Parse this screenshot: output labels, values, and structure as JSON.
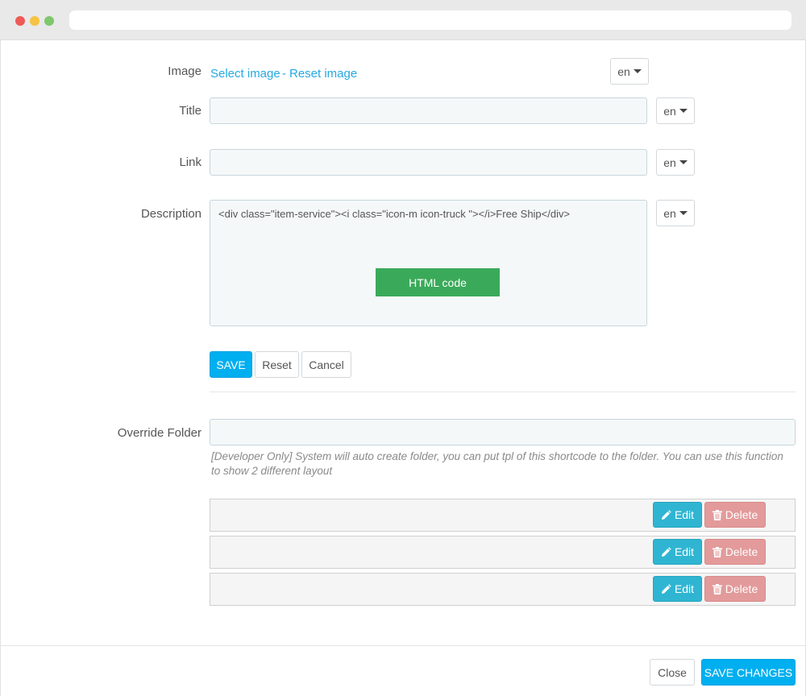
{
  "form": {
    "image": {
      "label": "Image",
      "select_link": "Select image",
      "separator": "-",
      "reset_link": "Reset image",
      "lang": "en"
    },
    "title": {
      "label": "Title",
      "value": "",
      "lang": "en"
    },
    "link": {
      "label": "Link",
      "value": "",
      "lang": "en"
    },
    "description": {
      "label": "Description",
      "value": "<div class=\"item-service\"><i class=\"icon-m icon-truck \"></i>Free Ship</div>",
      "badge": "HTML code",
      "lang": "en"
    },
    "buttons": {
      "save": "SAVE",
      "reset": "Reset",
      "cancel": "Cancel"
    },
    "override_folder": {
      "label": "Override Folder",
      "value": "",
      "help": "[Developer Only] System will auto create folder, you can put tpl of this shortcode to the folder. You can use this function to show 2 different layout"
    }
  },
  "items": [
    {
      "edit": "Edit",
      "delete": "Delete"
    },
    {
      "edit": "Edit",
      "delete": "Delete"
    },
    {
      "edit": "Edit",
      "delete": "Delete"
    }
  ],
  "footer": {
    "close": "Close",
    "save_changes": "SAVE CHANGES"
  },
  "icons": {
    "edit": "pencil-icon",
    "delete": "trash-icon",
    "lang_dropdown": "caret-down-icon"
  },
  "colors": {
    "primary": "#00aff0",
    "link": "#25a9e0",
    "edit": "#2fb5d2",
    "delete": "#e39a9a",
    "html_badge": "#3aaa5a"
  }
}
